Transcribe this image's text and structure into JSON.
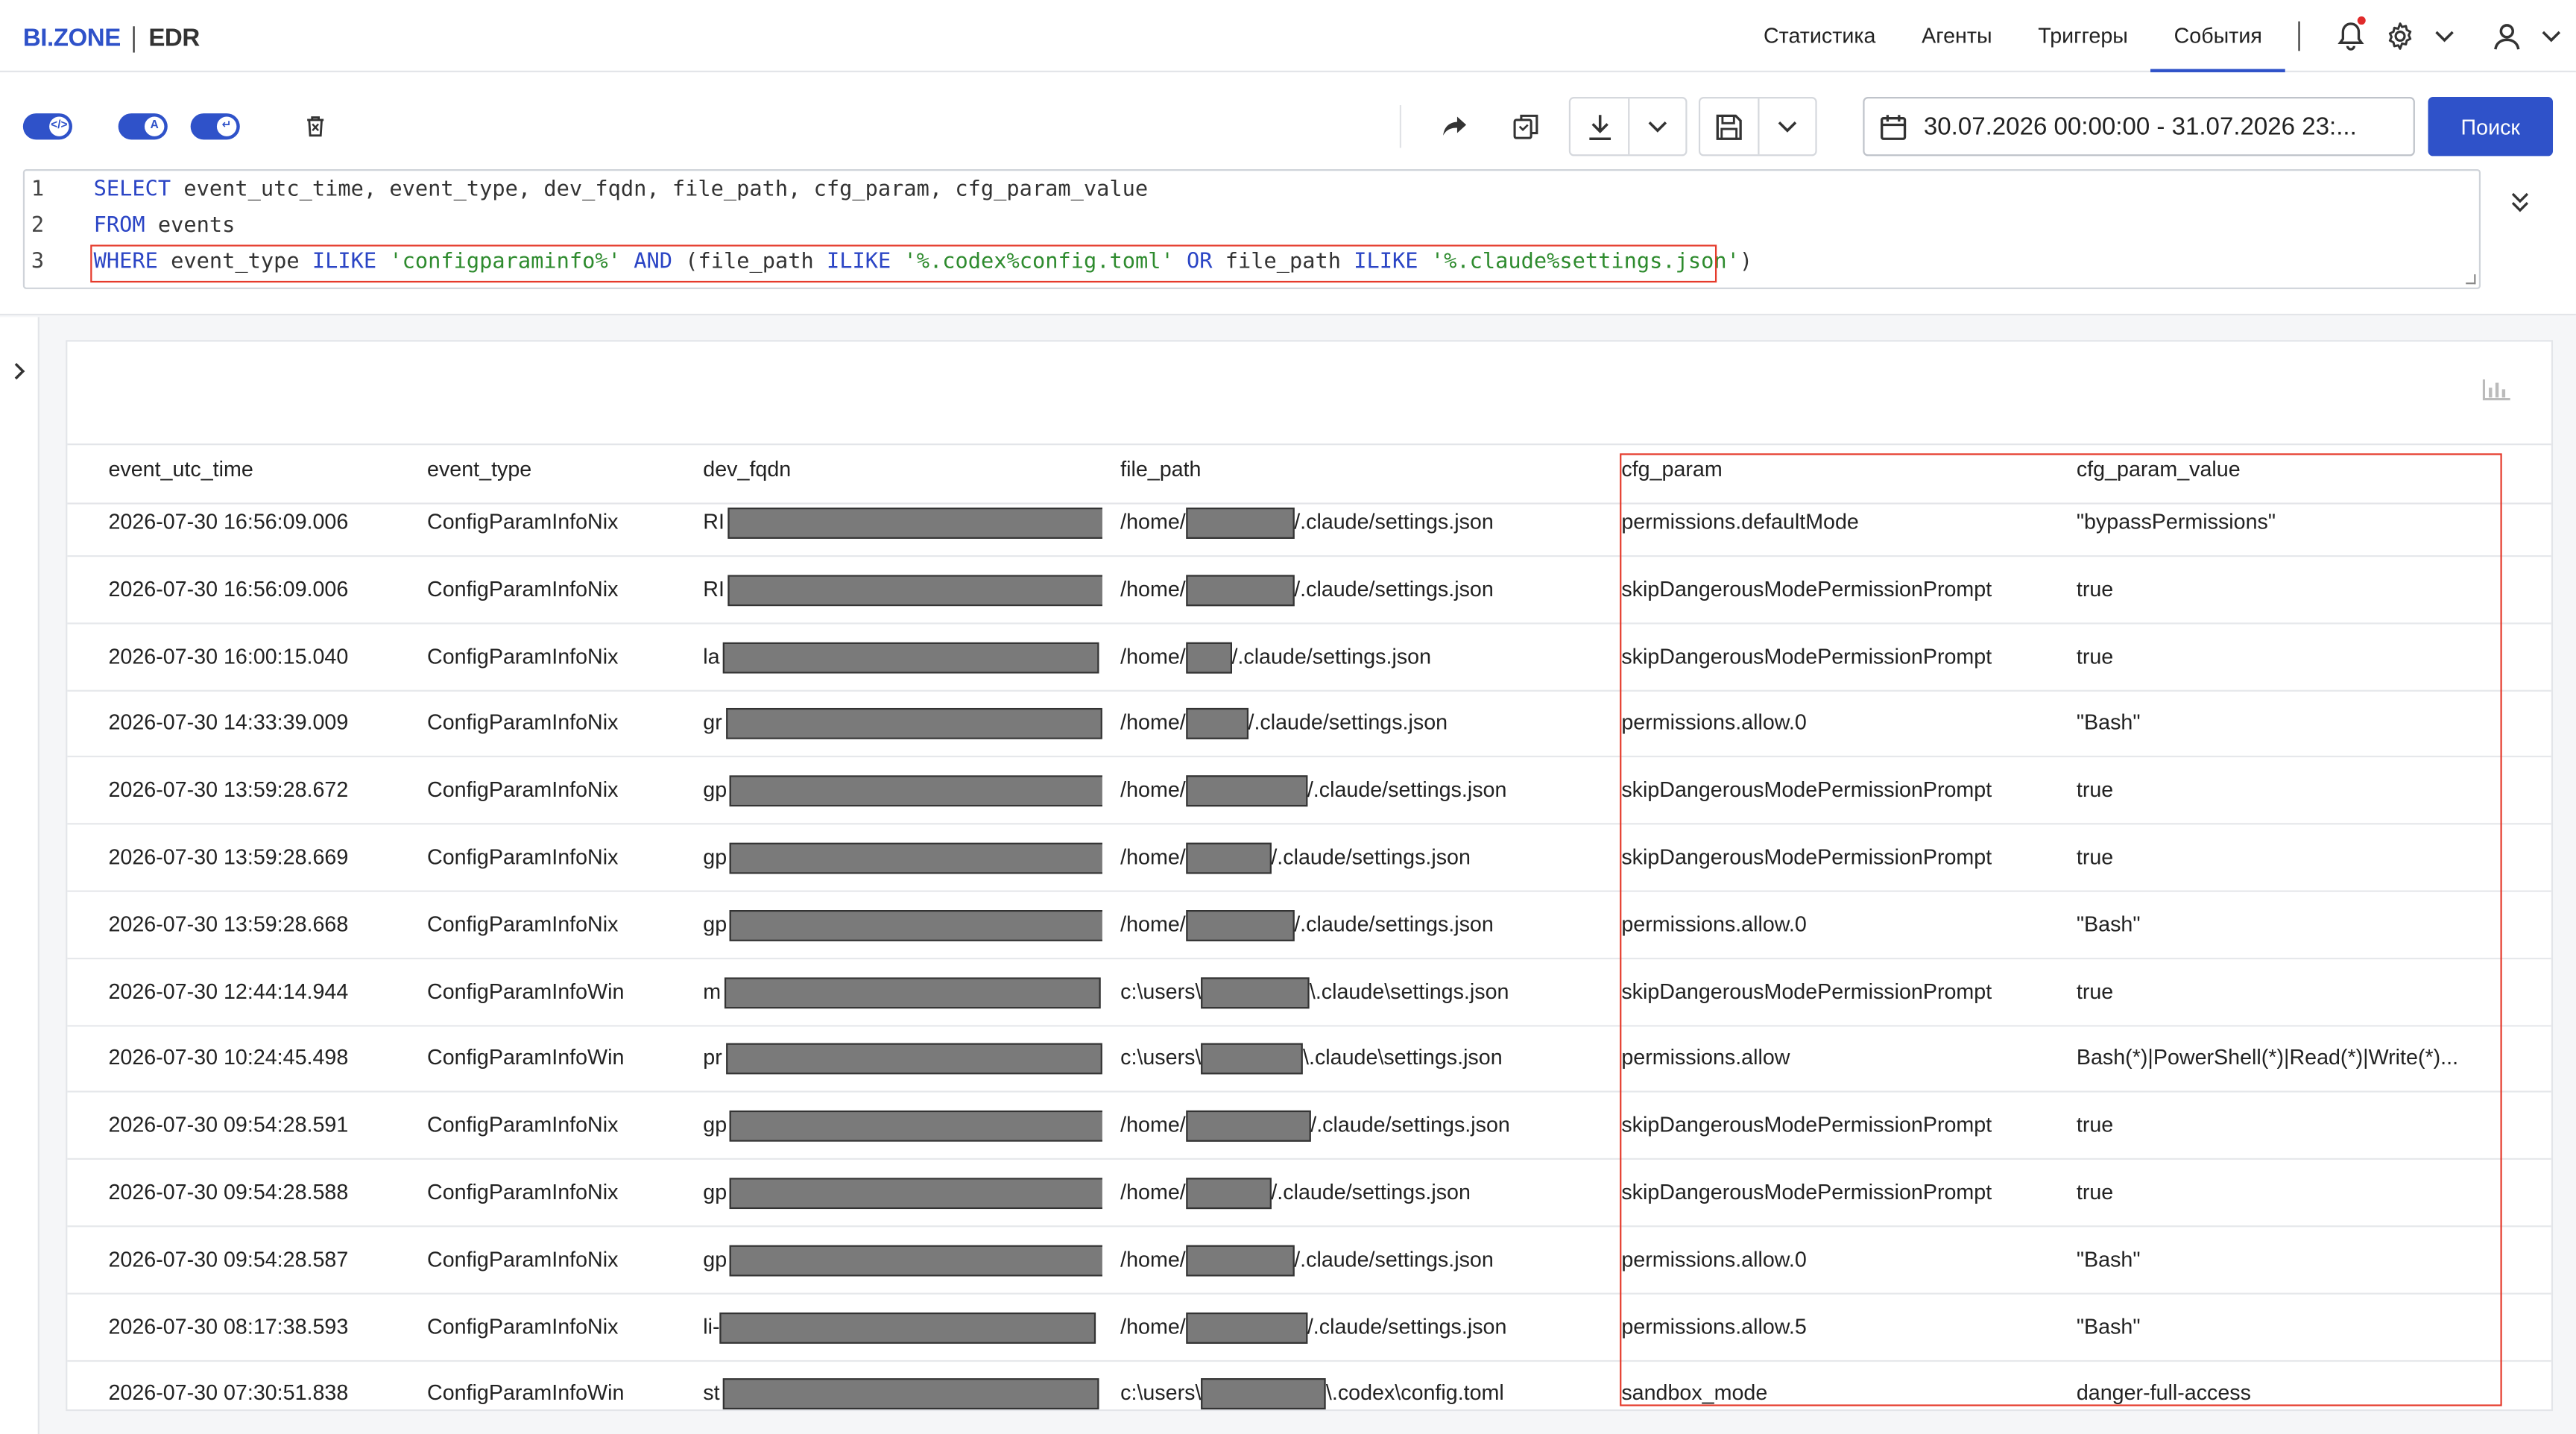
{
  "header": {
    "logo_primary": "BI.ZONE",
    "logo_secondary": "EDR",
    "nav": [
      "Статистика",
      "Агенты",
      "Триггеры",
      "События"
    ],
    "active_nav": "События"
  },
  "toolbar": {
    "toggle_a_label": "A",
    "date_range": "30.07.2026 00:00:00 - 31.07.2026 23:...",
    "search_label": "Поиск"
  },
  "query": {
    "lines": [
      {
        "n": "1",
        "parts": [
          [
            "kw",
            "SELECT "
          ],
          [
            "tx",
            "event_utc_time, event_type, dev_fqdn, file_path, cfg_param, cfg_param_value"
          ]
        ]
      },
      {
        "n": "2",
        "parts": [
          [
            "kw",
            "FROM "
          ],
          [
            "tx",
            "events"
          ]
        ]
      },
      {
        "n": "3",
        "parts": [
          [
            "kw",
            "WHERE "
          ],
          [
            "tx",
            "event_type "
          ],
          [
            "kw",
            "ILIKE "
          ],
          [
            "st",
            "'configparaminfo%'"
          ],
          [
            "kw",
            " AND "
          ],
          [
            "tx",
            "(file_path "
          ],
          [
            "kw",
            "ILIKE "
          ],
          [
            "st",
            "'%.codex%config.toml'"
          ],
          [
            "kw",
            " OR "
          ],
          [
            "tx",
            "file_path "
          ],
          [
            "kw",
            "ILIKE "
          ],
          [
            "st",
            "'%.claude%settings.json'"
          ],
          [
            "tx",
            ")"
          ]
        ]
      }
    ]
  },
  "table": {
    "columns": [
      "event_utc_time",
      "event_type",
      "dev_fqdn",
      "file_path",
      "cfg_param",
      "cfg_param_value"
    ],
    "rows": [
      {
        "time": "2026-07-30 16:56:09.006",
        "type": "ConfigParamInfoNix",
        "fqdn_prefix": "RI",
        "path_prefix": "/home/",
        "path_suffix": "/.claude/settings.json",
        "param": "permissions.defaultMode",
        "value": "\"bypassPermissions\""
      },
      {
        "time": "2026-07-30 16:56:09.006",
        "type": "ConfigParamInfoNix",
        "fqdn_prefix": "RI",
        "path_prefix": "/home/",
        "path_suffix": "/.claude/settings.json",
        "param": "skipDangerousModePermissionPrompt",
        "value": "true"
      },
      {
        "time": "2026-07-30 16:00:15.040",
        "type": "ConfigParamInfoNix",
        "fqdn_prefix": "la",
        "path_prefix": "/home/",
        "path_suffix": "/.claude/settings.json",
        "param": "skipDangerousModePermissionPrompt",
        "value": "true"
      },
      {
        "time": "2026-07-30 14:33:39.009",
        "type": "ConfigParamInfoNix",
        "fqdn_prefix": "gr",
        "path_prefix": "/home/",
        "path_suffix": "/.claude/settings.json",
        "param": "permissions.allow.0",
        "value": "\"Bash\""
      },
      {
        "time": "2026-07-30 13:59:28.672",
        "type": "ConfigParamInfoNix",
        "fqdn_prefix": "gp",
        "path_prefix": "/home/",
        "path_suffix": "/.claude/settings.json",
        "param": "skipDangerousModePermissionPrompt",
        "value": "true"
      },
      {
        "time": "2026-07-30 13:59:28.669",
        "type": "ConfigParamInfoNix",
        "fqdn_prefix": "gp",
        "path_prefix": "/home/",
        "path_suffix": "/.claude/settings.json",
        "param": "skipDangerousModePermissionPrompt",
        "value": "true"
      },
      {
        "time": "2026-07-30 13:59:28.668",
        "type": "ConfigParamInfoNix",
        "fqdn_prefix": "gp",
        "path_prefix": "/home/",
        "path_suffix": "/.claude/settings.json",
        "param": "permissions.allow.0",
        "value": "\"Bash\""
      },
      {
        "time": "2026-07-30 12:44:14.944",
        "type": "ConfigParamInfoWin",
        "fqdn_prefix": "m",
        "path_prefix": "c:\\users\\",
        "path_suffix": "\\.claude\\settings.json",
        "param": "skipDangerousModePermissionPrompt",
        "value": "true"
      },
      {
        "time": "2026-07-30 10:24:45.498",
        "type": "ConfigParamInfoWin",
        "fqdn_prefix": "pr",
        "path_prefix": "c:\\users\\",
        "path_suffix": "\\.claude\\settings.json",
        "param": "permissions.allow",
        "value": "Bash(*)|PowerShell(*)|Read(*)|Write(*)..."
      },
      {
        "time": "2026-07-30 09:54:28.591",
        "type": "ConfigParamInfoNix",
        "fqdn_prefix": "gp",
        "path_prefix": "/home/",
        "path_suffix": "/.claude/settings.json",
        "param": "skipDangerousModePermissionPrompt",
        "value": "true"
      },
      {
        "time": "2026-07-30 09:54:28.588",
        "type": "ConfigParamInfoNix",
        "fqdn_prefix": "gp",
        "path_prefix": "/home/",
        "path_suffix": "/.claude/settings.json",
        "param": "skipDangerousModePermissionPrompt",
        "value": "true"
      },
      {
        "time": "2026-07-30 09:54:28.587",
        "type": "ConfigParamInfoNix",
        "fqdn_prefix": "gp",
        "path_prefix": "/home/",
        "path_suffix": "/.claude/settings.json",
        "param": "permissions.allow.0",
        "value": "\"Bash\""
      },
      {
        "time": "2026-07-30 08:17:38.593",
        "type": "ConfigParamInfoNix",
        "fqdn_prefix": "li-",
        "path_prefix": "/home/",
        "path_suffix": "/.claude/settings.json",
        "param": "permissions.allow.5",
        "value": "\"Bash\""
      },
      {
        "time": "2026-07-30 07:30:51.838",
        "type": "ConfigParamInfoWin",
        "fqdn_prefix": "st",
        "path_prefix": "c:\\users\\",
        "path_suffix": "\\.codex\\config.toml",
        "param": "sandbox_mode",
        "value": "danger-full-access"
      }
    ]
  },
  "colors": {
    "accent": "#2f52c9",
    "highlight": "#e53a2b",
    "redaction": "#7a7a7a"
  }
}
